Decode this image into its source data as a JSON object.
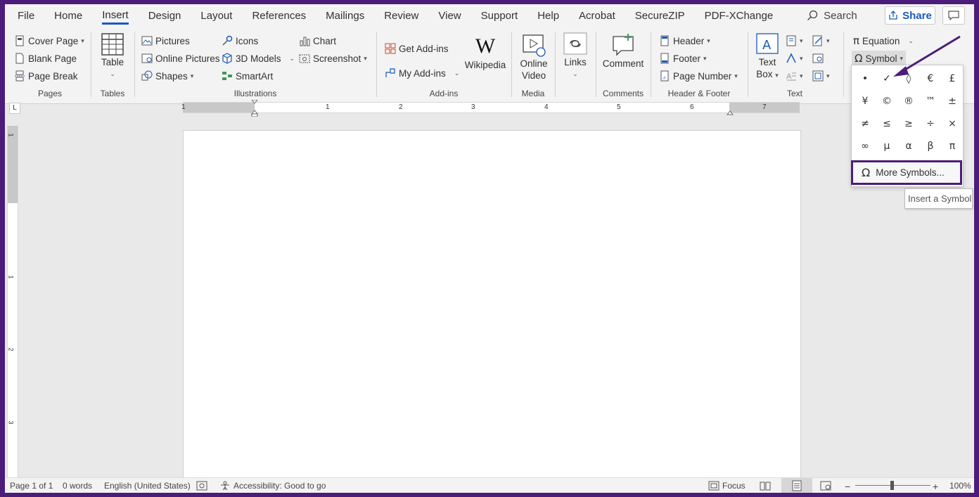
{
  "tabs": [
    "File",
    "Home",
    "Insert",
    "Design",
    "Layout",
    "References",
    "Mailings",
    "Review",
    "View",
    "Support",
    "Help",
    "Acrobat",
    "SecureZIP",
    "PDF-XChange"
  ],
  "active_tab": "Insert",
  "search": {
    "label": "Search"
  },
  "share": {
    "label": "Share"
  },
  "groups": {
    "pages": {
      "label": "Pages",
      "cover_page": "Cover Page",
      "blank_page": "Blank Page",
      "page_break": "Page Break"
    },
    "tables": {
      "label": "Tables",
      "table": "Table"
    },
    "illustrations": {
      "label": "Illustrations",
      "pictures": "Pictures",
      "online_pictures": "Online Pictures",
      "shapes": "Shapes",
      "icons": "Icons",
      "models_3d": "3D Models",
      "smartart": "SmartArt",
      "chart": "Chart",
      "screenshot": "Screenshot"
    },
    "addins": {
      "label": "Add-ins",
      "get_addins": "Get Add-ins",
      "my_addins": "My Add-ins",
      "wikipedia": "Wikipedia"
    },
    "media": {
      "label": "Media",
      "online_video_1": "Online",
      "online_video_2": "Video"
    },
    "links": {
      "label": "Links"
    },
    "comments": {
      "label": "Comments",
      "comment": "Comment"
    },
    "header_footer": {
      "label": "Header & Footer",
      "header": "Header",
      "footer": "Footer",
      "page_number": "Page Number"
    },
    "text": {
      "label": "Text",
      "text_box_1": "Text",
      "text_box_2": "Box"
    },
    "symbols": {
      "equation": "Equation",
      "symbol": "Symbol"
    }
  },
  "ruler": {
    "h_numbers": [
      "1",
      "1",
      "2",
      "3",
      "4",
      "5",
      "6",
      "7"
    ],
    "v_numbers": [
      "1",
      "1",
      "2",
      "3"
    ]
  },
  "symbol_panel": {
    "symbols": [
      "•",
      "✓",
      "◊",
      "€",
      "£",
      "¥",
      "©",
      "®",
      "™",
      "±",
      "≠",
      "≤",
      "≥",
      "÷",
      "×",
      "∞",
      "μ",
      "α",
      "β",
      "π"
    ],
    "more_symbols": "More Symbols...",
    "tooltip": "Insert a Symbol"
  },
  "status": {
    "page": "Page 1 of 1",
    "words": "0 words",
    "language": "English (United States)",
    "accessibility": "Accessibility: Good to go",
    "focus": "Focus",
    "zoom": "100%"
  },
  "colors": {
    "accent": "#185abd",
    "frame": "#4b1c7a",
    "highlight_border": "#4b1c7a"
  }
}
